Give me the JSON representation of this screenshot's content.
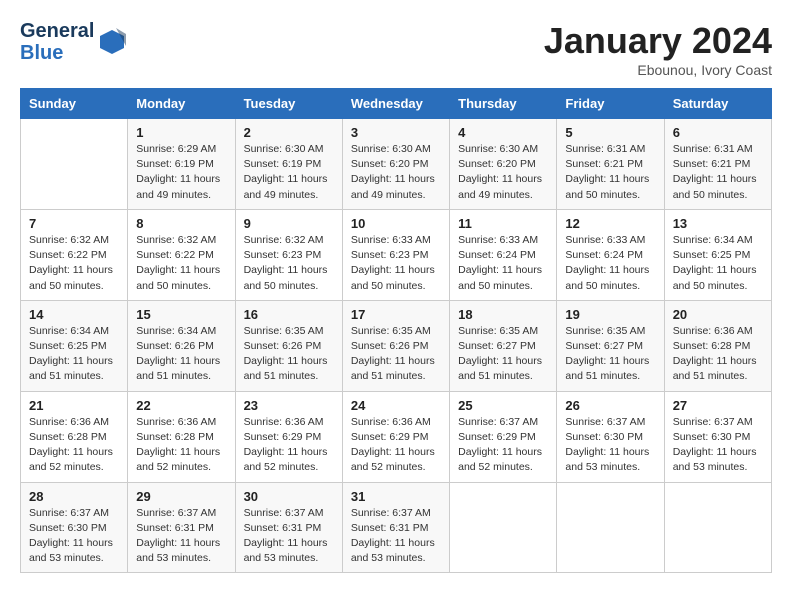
{
  "header": {
    "logo_line1": "General",
    "logo_line2": "Blue",
    "month": "January 2024",
    "location": "Ebounou, Ivory Coast"
  },
  "weekdays": [
    "Sunday",
    "Monday",
    "Tuesday",
    "Wednesday",
    "Thursday",
    "Friday",
    "Saturday"
  ],
  "weeks": [
    [
      {
        "day": "",
        "sunrise": "",
        "sunset": "",
        "daylight": ""
      },
      {
        "day": "1",
        "sunrise": "Sunrise: 6:29 AM",
        "sunset": "Sunset: 6:19 PM",
        "daylight": "Daylight: 11 hours and 49 minutes."
      },
      {
        "day": "2",
        "sunrise": "Sunrise: 6:30 AM",
        "sunset": "Sunset: 6:19 PM",
        "daylight": "Daylight: 11 hours and 49 minutes."
      },
      {
        "day": "3",
        "sunrise": "Sunrise: 6:30 AM",
        "sunset": "Sunset: 6:20 PM",
        "daylight": "Daylight: 11 hours and 49 minutes."
      },
      {
        "day": "4",
        "sunrise": "Sunrise: 6:30 AM",
        "sunset": "Sunset: 6:20 PM",
        "daylight": "Daylight: 11 hours and 49 minutes."
      },
      {
        "day": "5",
        "sunrise": "Sunrise: 6:31 AM",
        "sunset": "Sunset: 6:21 PM",
        "daylight": "Daylight: 11 hours and 50 minutes."
      },
      {
        "day": "6",
        "sunrise": "Sunrise: 6:31 AM",
        "sunset": "Sunset: 6:21 PM",
        "daylight": "Daylight: 11 hours and 50 minutes."
      }
    ],
    [
      {
        "day": "7",
        "sunrise": "Sunrise: 6:32 AM",
        "sunset": "Sunset: 6:22 PM",
        "daylight": "Daylight: 11 hours and 50 minutes."
      },
      {
        "day": "8",
        "sunrise": "Sunrise: 6:32 AM",
        "sunset": "Sunset: 6:22 PM",
        "daylight": "Daylight: 11 hours and 50 minutes."
      },
      {
        "day": "9",
        "sunrise": "Sunrise: 6:32 AM",
        "sunset": "Sunset: 6:23 PM",
        "daylight": "Daylight: 11 hours and 50 minutes."
      },
      {
        "day": "10",
        "sunrise": "Sunrise: 6:33 AM",
        "sunset": "Sunset: 6:23 PM",
        "daylight": "Daylight: 11 hours and 50 minutes."
      },
      {
        "day": "11",
        "sunrise": "Sunrise: 6:33 AM",
        "sunset": "Sunset: 6:24 PM",
        "daylight": "Daylight: 11 hours and 50 minutes."
      },
      {
        "day": "12",
        "sunrise": "Sunrise: 6:33 AM",
        "sunset": "Sunset: 6:24 PM",
        "daylight": "Daylight: 11 hours and 50 minutes."
      },
      {
        "day": "13",
        "sunrise": "Sunrise: 6:34 AM",
        "sunset": "Sunset: 6:25 PM",
        "daylight": "Daylight: 11 hours and 50 minutes."
      }
    ],
    [
      {
        "day": "14",
        "sunrise": "Sunrise: 6:34 AM",
        "sunset": "Sunset: 6:25 PM",
        "daylight": "Daylight: 11 hours and 51 minutes."
      },
      {
        "day": "15",
        "sunrise": "Sunrise: 6:34 AM",
        "sunset": "Sunset: 6:26 PM",
        "daylight": "Daylight: 11 hours and 51 minutes."
      },
      {
        "day": "16",
        "sunrise": "Sunrise: 6:35 AM",
        "sunset": "Sunset: 6:26 PM",
        "daylight": "Daylight: 11 hours and 51 minutes."
      },
      {
        "day": "17",
        "sunrise": "Sunrise: 6:35 AM",
        "sunset": "Sunset: 6:26 PM",
        "daylight": "Daylight: 11 hours and 51 minutes."
      },
      {
        "day": "18",
        "sunrise": "Sunrise: 6:35 AM",
        "sunset": "Sunset: 6:27 PM",
        "daylight": "Daylight: 11 hours and 51 minutes."
      },
      {
        "day": "19",
        "sunrise": "Sunrise: 6:35 AM",
        "sunset": "Sunset: 6:27 PM",
        "daylight": "Daylight: 11 hours and 51 minutes."
      },
      {
        "day": "20",
        "sunrise": "Sunrise: 6:36 AM",
        "sunset": "Sunset: 6:28 PM",
        "daylight": "Daylight: 11 hours and 51 minutes."
      }
    ],
    [
      {
        "day": "21",
        "sunrise": "Sunrise: 6:36 AM",
        "sunset": "Sunset: 6:28 PM",
        "daylight": "Daylight: 11 hours and 52 minutes."
      },
      {
        "day": "22",
        "sunrise": "Sunrise: 6:36 AM",
        "sunset": "Sunset: 6:28 PM",
        "daylight": "Daylight: 11 hours and 52 minutes."
      },
      {
        "day": "23",
        "sunrise": "Sunrise: 6:36 AM",
        "sunset": "Sunset: 6:29 PM",
        "daylight": "Daylight: 11 hours and 52 minutes."
      },
      {
        "day": "24",
        "sunrise": "Sunrise: 6:36 AM",
        "sunset": "Sunset: 6:29 PM",
        "daylight": "Daylight: 11 hours and 52 minutes."
      },
      {
        "day": "25",
        "sunrise": "Sunrise: 6:37 AM",
        "sunset": "Sunset: 6:29 PM",
        "daylight": "Daylight: 11 hours and 52 minutes."
      },
      {
        "day": "26",
        "sunrise": "Sunrise: 6:37 AM",
        "sunset": "Sunset: 6:30 PM",
        "daylight": "Daylight: 11 hours and 53 minutes."
      },
      {
        "day": "27",
        "sunrise": "Sunrise: 6:37 AM",
        "sunset": "Sunset: 6:30 PM",
        "daylight": "Daylight: 11 hours and 53 minutes."
      }
    ],
    [
      {
        "day": "28",
        "sunrise": "Sunrise: 6:37 AM",
        "sunset": "Sunset: 6:30 PM",
        "daylight": "Daylight: 11 hours and 53 minutes."
      },
      {
        "day": "29",
        "sunrise": "Sunrise: 6:37 AM",
        "sunset": "Sunset: 6:31 PM",
        "daylight": "Daylight: 11 hours and 53 minutes."
      },
      {
        "day": "30",
        "sunrise": "Sunrise: 6:37 AM",
        "sunset": "Sunset: 6:31 PM",
        "daylight": "Daylight: 11 hours and 53 minutes."
      },
      {
        "day": "31",
        "sunrise": "Sunrise: 6:37 AM",
        "sunset": "Sunset: 6:31 PM",
        "daylight": "Daylight: 11 hours and 53 minutes."
      },
      {
        "day": "",
        "sunrise": "",
        "sunset": "",
        "daylight": ""
      },
      {
        "day": "",
        "sunrise": "",
        "sunset": "",
        "daylight": ""
      },
      {
        "day": "",
        "sunrise": "",
        "sunset": "",
        "daylight": ""
      }
    ]
  ]
}
